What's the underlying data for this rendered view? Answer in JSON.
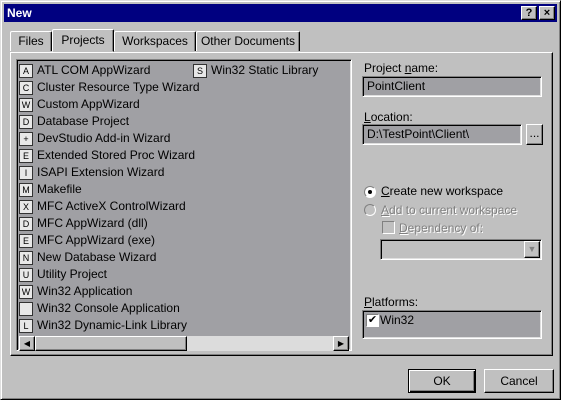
{
  "window": {
    "title": "New",
    "help_glyph": "?",
    "close_glyph": "×"
  },
  "tabs": [
    {
      "label": "Files",
      "active": false
    },
    {
      "label": "Projects",
      "active": true
    },
    {
      "label": "Workspaces",
      "active": false
    },
    {
      "label": "Other Documents",
      "active": false
    }
  ],
  "project_types": [
    {
      "label": "ATL COM AppWizard",
      "icon": "atl-wizard-icon",
      "glyph": "A"
    },
    {
      "label": "Cluster Resource Type Wizard",
      "icon": "cluster-wizard-icon",
      "glyph": "C"
    },
    {
      "label": "Custom AppWizard",
      "icon": "custom-wizard-icon",
      "glyph": "W"
    },
    {
      "label": "Database Project",
      "icon": "database-project-icon",
      "glyph": "D"
    },
    {
      "label": "DevStudio Add-in Wizard",
      "icon": "addin-wizard-icon",
      "glyph": "+"
    },
    {
      "label": "Extended Stored Proc Wizard",
      "icon": "stored-proc-icon",
      "glyph": "E"
    },
    {
      "label": "ISAPI Extension Wizard",
      "icon": "isapi-wizard-icon",
      "glyph": "I"
    },
    {
      "label": "Makefile",
      "icon": "makefile-icon",
      "glyph": "M"
    },
    {
      "label": "MFC ActiveX ControlWizard",
      "icon": "activex-wizard-icon",
      "glyph": "X"
    },
    {
      "label": "MFC AppWizard (dll)",
      "icon": "mfc-dll-icon",
      "glyph": "D"
    },
    {
      "label": "MFC AppWizard (exe)",
      "icon": "mfc-exe-icon",
      "glyph": "E"
    },
    {
      "label": "New Database Wizard",
      "icon": "new-database-icon",
      "glyph": "N"
    },
    {
      "label": "Utility Project",
      "icon": "utility-project-icon",
      "glyph": "U"
    },
    {
      "label": "Win32 Application",
      "icon": "win32-app-icon",
      "glyph": "W"
    },
    {
      "label": "Win32 Console Application",
      "icon": "win32-console-icon",
      "glyph": ""
    },
    {
      "label": "Win32 Dynamic-Link Library",
      "icon": "win32-dll-icon",
      "glyph": "L"
    },
    {
      "label": "Win32 Static Library",
      "icon": "win32-static-lib-icon",
      "glyph": "S"
    }
  ],
  "project_name": {
    "label_pre": "Project ",
    "label_key": "n",
    "label_post": "ame:",
    "value": "PointClient"
  },
  "location": {
    "label_pre": "",
    "label_key": "L",
    "label_post": "ocation:",
    "value": "D:\\TestPoint\\Client\\",
    "browse_label": "..."
  },
  "workspace_options": {
    "create_new": {
      "label_pre": "",
      "label_key": "C",
      "label_post": "reate new workspace",
      "selected": true
    },
    "add_current": {
      "label_pre": "",
      "label_key": "A",
      "label_post": "dd to current workspace",
      "selected": false,
      "enabled": false
    },
    "dependency": {
      "label_pre": "",
      "label_key": "D",
      "label_post": "ependency of:",
      "checked": false,
      "enabled": false,
      "value": ""
    }
  },
  "platforms": {
    "label_pre": "",
    "label_key": "P",
    "label_post": "latforms:",
    "items": [
      {
        "label": "Win32",
        "checked": true
      }
    ]
  },
  "buttons": {
    "ok": "OK",
    "cancel": "Cancel"
  },
  "scrollbar": {
    "left_arrow": "◀",
    "right_arrow": "▶"
  },
  "combo_arrow": "▼",
  "checkmark": "✔"
}
